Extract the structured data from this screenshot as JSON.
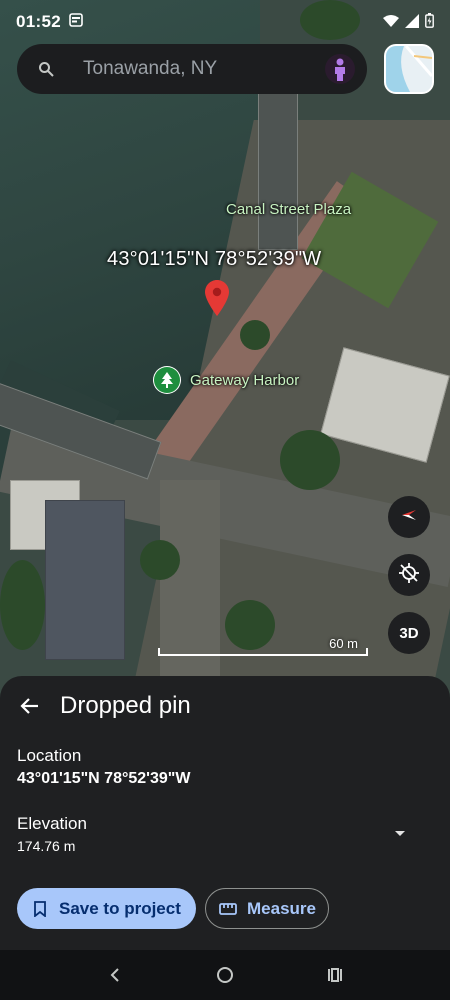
{
  "status_bar": {
    "time": "01:52",
    "icons": [
      "gallery-icon",
      "wifi-icon",
      "signal-icon",
      "battery-icon"
    ]
  },
  "search": {
    "placeholder": "Tonawanda, NY",
    "icon": "search-icon"
  },
  "map": {
    "place_labels": [
      "Canal Street Plaza",
      "Gateway Harbor"
    ],
    "coordinate_label": "43°01'15\"N 78°52'39\"W",
    "scale_label": "60 m",
    "controls": {
      "compass": "compass-icon",
      "location": "location-disabled-icon",
      "three_d_label": "3D"
    },
    "colors": {
      "pin": "#e53935",
      "poi": "#1e8e3e"
    }
  },
  "sheet": {
    "title": "Dropped pin",
    "location_label": "Location",
    "location_value": "43°01'15\"N 78°52'39\"W",
    "elevation_label": "Elevation",
    "elevation_value": "174.76 m",
    "save_button": "Save to project",
    "measure_button": "Measure",
    "colors": {
      "primary": "#a8c7fa",
      "on_primary": "#062e6f"
    }
  },
  "navbar": [
    "back-icon",
    "home-icon",
    "recents-icon"
  ]
}
